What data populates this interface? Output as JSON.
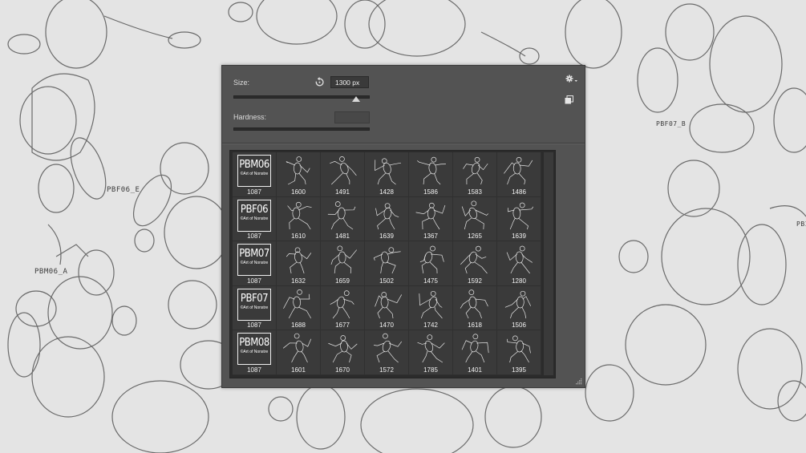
{
  "background": {
    "labels": [
      "PBF06_E",
      "PBM06_A",
      "PBF07_B",
      "PBI"
    ]
  },
  "panel": {
    "size_label": "Size:",
    "size_value": "1300 px",
    "size_slider_percent": 90,
    "hardness_label": "Hardness:",
    "hardness_value": "",
    "icons": {
      "reset": "reset-size-icon",
      "gear": "gear-dropdown-icon",
      "new_preset": "new-preset-icon",
      "grip": "resize-grip-icon"
    }
  },
  "brushes": [
    [
      {
        "type": "set",
        "code": "PBM06",
        "sub": "©Art of Nonstre",
        "size": "1087"
      },
      {
        "type": "pose",
        "size": "1600"
      },
      {
        "type": "pose",
        "size": "1491"
      },
      {
        "type": "pose",
        "size": "1428"
      },
      {
        "type": "pose",
        "size": "1586"
      },
      {
        "type": "pose",
        "size": "1583"
      },
      {
        "type": "pose",
        "size": "1486"
      }
    ],
    [
      {
        "type": "set",
        "code": "PBF06",
        "sub": "©Art of Nonstre",
        "size": "1087"
      },
      {
        "type": "pose",
        "size": "1610"
      },
      {
        "type": "pose",
        "size": "1481"
      },
      {
        "type": "pose",
        "size": "1639"
      },
      {
        "type": "pose",
        "size": "1367"
      },
      {
        "type": "pose",
        "size": "1265"
      },
      {
        "type": "pose",
        "size": "1639"
      }
    ],
    [
      {
        "type": "set",
        "code": "PBM07",
        "sub": "©Art of Nonstre",
        "size": "1087"
      },
      {
        "type": "pose",
        "size": "1632"
      },
      {
        "type": "pose",
        "size": "1659"
      },
      {
        "type": "pose",
        "size": "1502"
      },
      {
        "type": "pose",
        "size": "1475"
      },
      {
        "type": "pose",
        "size": "1592"
      },
      {
        "type": "pose",
        "size": "1280"
      }
    ],
    [
      {
        "type": "set",
        "code": "PBF07",
        "sub": "©Art of Nonstre",
        "size": "1087"
      },
      {
        "type": "pose",
        "size": "1688"
      },
      {
        "type": "pose",
        "size": "1677"
      },
      {
        "type": "pose",
        "size": "1470"
      },
      {
        "type": "pose",
        "size": "1742"
      },
      {
        "type": "pose",
        "size": "1618"
      },
      {
        "type": "pose",
        "size": "1506"
      }
    ],
    [
      {
        "type": "set",
        "code": "PBM08",
        "sub": "©Art of Nonstre",
        "size": "1087"
      },
      {
        "type": "pose",
        "size": "1601"
      },
      {
        "type": "pose",
        "size": "1670"
      },
      {
        "type": "pose",
        "size": "1572"
      },
      {
        "type": "pose",
        "size": "1785"
      },
      {
        "type": "pose",
        "size": "1401"
      },
      {
        "type": "pose",
        "size": "1395"
      }
    ]
  ]
}
